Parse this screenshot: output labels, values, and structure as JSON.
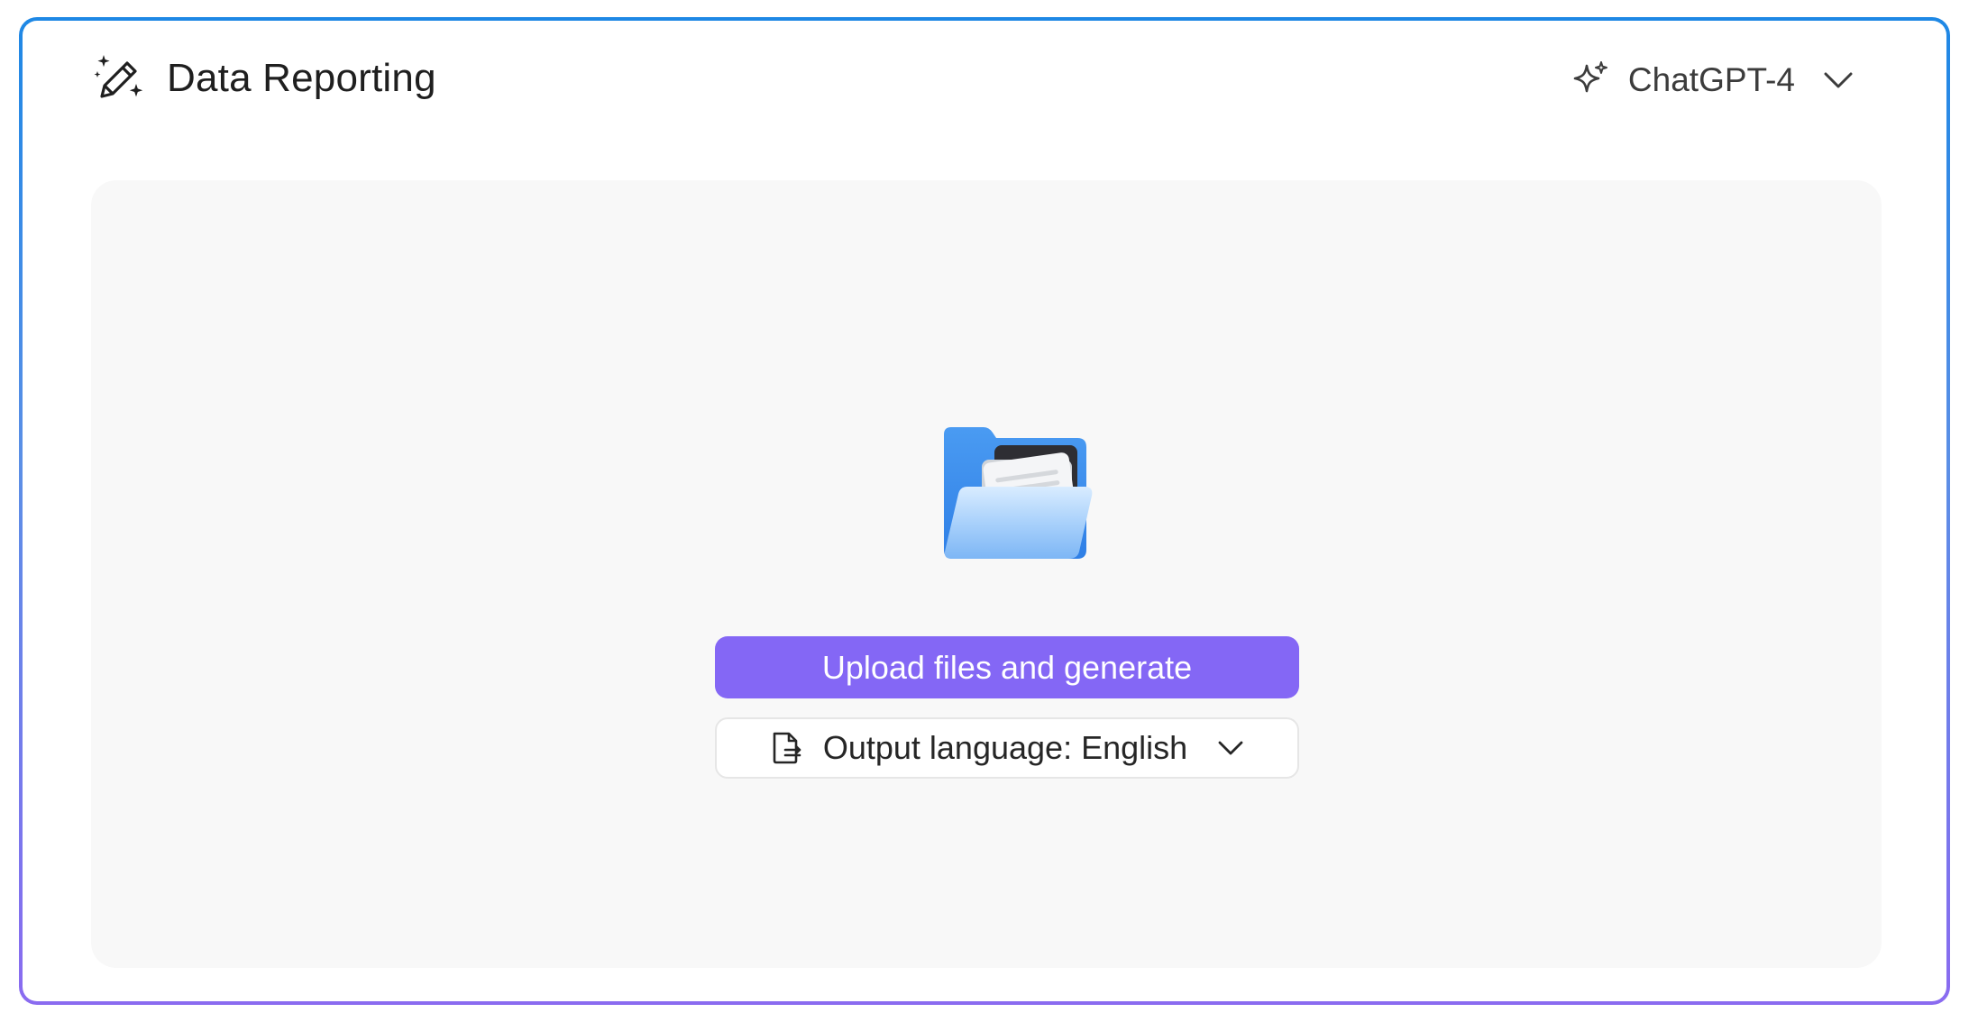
{
  "header": {
    "title": "Data Reporting",
    "title_icon": "magic-pencil-icon",
    "model_selector": {
      "icon": "sparkle-icon",
      "label": "ChatGPT-4",
      "chevron_icon": "chevron-down-icon"
    }
  },
  "dropzone": {
    "illustration_icon": "open-folder-icon",
    "upload_button_label": "Upload files and generate",
    "output_language": {
      "icon": "document-translate-icon",
      "label": "Output language: English",
      "chevron_icon": "chevron-down-icon"
    }
  },
  "colors": {
    "accent": "#8467f5",
    "frame_gradient_top": "#1e88e5",
    "frame_gradient_bottom": "#8a6bf0",
    "dropzone_bg": "#f8f8f8"
  }
}
